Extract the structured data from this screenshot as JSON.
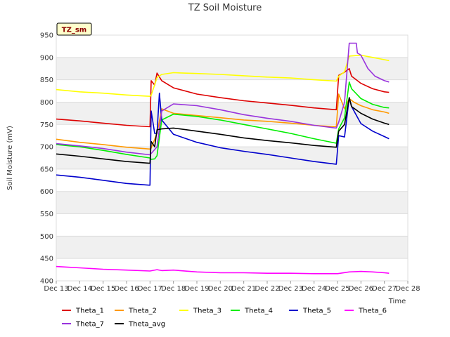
{
  "chart_data": {
    "type": "line",
    "title": "TZ Soil Moisture",
    "xlabel": "Time",
    "ylabel": "Soil Moisture (mV)",
    "badge": "TZ_sm",
    "ylim": [
      400,
      950
    ],
    "xlim": [
      13,
      28
    ],
    "yticks": [
      400,
      450,
      500,
      550,
      600,
      650,
      700,
      750,
      800,
      850,
      900,
      950
    ],
    "xtick_labels": [
      "Dec 13",
      "Dec 14",
      "Dec 15",
      "Dec 16",
      "Dec 17",
      "Dec 18",
      "Dec 19",
      "Dec 20",
      "Dec 21",
      "Dec 22",
      "Dec 23",
      "Dec 24",
      "Dec 25",
      "Dec 26",
      "Dec 27",
      "Dec 28"
    ],
    "xtick_values": [
      13,
      14,
      15,
      16,
      17,
      18,
      19,
      20,
      21,
      22,
      23,
      24,
      25,
      26,
      27,
      28
    ],
    "grid": true,
    "legend_position": "bottom",
    "series": [
      {
        "name": "Theta_1",
        "color": "#dd0000",
        "points": [
          [
            13,
            762
          ],
          [
            14,
            758
          ],
          [
            15,
            753
          ],
          [
            16,
            748
          ],
          [
            17.0,
            745
          ],
          [
            17.05,
            848
          ],
          [
            17.2,
            838
          ],
          [
            17.3,
            865
          ],
          [
            17.5,
            848
          ],
          [
            18,
            832
          ],
          [
            19,
            818
          ],
          [
            20,
            810
          ],
          [
            21,
            803
          ],
          [
            22,
            798
          ],
          [
            23,
            793
          ],
          [
            24,
            787
          ],
          [
            24.95,
            783
          ],
          [
            25.05,
            860
          ],
          [
            25.3,
            867
          ],
          [
            25.5,
            875
          ],
          [
            25.6,
            858
          ],
          [
            26,
            842
          ],
          [
            26.5,
            830
          ],
          [
            27,
            823
          ],
          [
            27.2,
            822
          ]
        ]
      },
      {
        "name": "Theta_2",
        "color": "#ff9900",
        "points": [
          [
            13,
            717
          ],
          [
            14,
            710
          ],
          [
            15,
            705
          ],
          [
            16,
            699
          ],
          [
            17.0,
            695
          ],
          [
            17.05,
            697
          ],
          [
            17.3,
            730
          ],
          [
            17.5,
            785
          ],
          [
            18,
            775
          ],
          [
            19,
            770
          ],
          [
            20,
            765
          ],
          [
            21,
            760
          ],
          [
            22,
            757
          ],
          [
            23,
            753
          ],
          [
            24,
            748
          ],
          [
            24.95,
            745
          ],
          [
            25.05,
            818
          ],
          [
            25.3,
            785
          ],
          [
            25.5,
            808
          ],
          [
            25.7,
            800
          ],
          [
            26,
            792
          ],
          [
            26.5,
            783
          ],
          [
            27,
            778
          ],
          [
            27.2,
            775
          ]
        ]
      },
      {
        "name": "Theta_3",
        "color": "#ffff00",
        "points": [
          [
            13,
            828
          ],
          [
            14,
            823
          ],
          [
            15,
            820
          ],
          [
            16,
            816
          ],
          [
            17.0,
            813
          ],
          [
            17.05,
            815
          ],
          [
            17.3,
            855
          ],
          [
            17.5,
            862
          ],
          [
            18,
            866
          ],
          [
            19,
            864
          ],
          [
            20,
            862
          ],
          [
            21,
            859
          ],
          [
            22,
            856
          ],
          [
            23,
            854
          ],
          [
            24,
            850
          ],
          [
            24.95,
            847
          ],
          [
            25.05,
            858
          ],
          [
            25.3,
            868
          ],
          [
            25.5,
            903
          ],
          [
            26,
            905
          ],
          [
            26.5,
            900
          ],
          [
            27,
            895
          ],
          [
            27.2,
            893
          ]
        ]
      },
      {
        "name": "Theta_4",
        "color": "#00ee00",
        "points": [
          [
            13,
            705
          ],
          [
            14,
            700
          ],
          [
            15,
            692
          ],
          [
            16,
            683
          ],
          [
            17.0,
            675
          ],
          [
            17.05,
            672
          ],
          [
            17.2,
            673
          ],
          [
            17.3,
            680
          ],
          [
            17.5,
            760
          ],
          [
            18,
            773
          ],
          [
            19,
            768
          ],
          [
            20,
            760
          ],
          [
            21,
            750
          ],
          [
            22,
            740
          ],
          [
            23,
            730
          ],
          [
            24,
            718
          ],
          [
            24.95,
            708
          ],
          [
            25.05,
            740
          ],
          [
            25.3,
            765
          ],
          [
            25.5,
            845
          ],
          [
            25.6,
            830
          ],
          [
            26,
            808
          ],
          [
            26.5,
            795
          ],
          [
            27,
            788
          ],
          [
            27.2,
            787
          ]
        ]
      },
      {
        "name": "Theta_5",
        "color": "#0000cc",
        "points": [
          [
            13,
            637
          ],
          [
            14,
            632
          ],
          [
            15,
            625
          ],
          [
            16,
            618
          ],
          [
            17.0,
            614
          ],
          [
            17.05,
            780
          ],
          [
            17.2,
            730
          ],
          [
            17.3,
            730
          ],
          [
            17.4,
            820
          ],
          [
            17.5,
            760
          ],
          [
            18,
            728
          ],
          [
            19,
            710
          ],
          [
            20,
            698
          ],
          [
            21,
            690
          ],
          [
            22,
            683
          ],
          [
            23,
            675
          ],
          [
            24,
            667
          ],
          [
            24.95,
            661
          ],
          [
            25.05,
            725
          ],
          [
            25.3,
            722
          ],
          [
            25.5,
            810
          ],
          [
            25.6,
            790
          ],
          [
            26,
            752
          ],
          [
            26.5,
            735
          ],
          [
            27,
            723
          ],
          [
            27.2,
            718
          ]
        ]
      },
      {
        "name": "Theta_6",
        "color": "#ff00ff",
        "points": [
          [
            13,
            432
          ],
          [
            14,
            429
          ],
          [
            15,
            426
          ],
          [
            16,
            424
          ],
          [
            17,
            422
          ],
          [
            17.3,
            425
          ],
          [
            17.5,
            423
          ],
          [
            18,
            424
          ],
          [
            19,
            420
          ],
          [
            20,
            418
          ],
          [
            21,
            418
          ],
          [
            22,
            417
          ],
          [
            23,
            417
          ],
          [
            24,
            416
          ],
          [
            25,
            416
          ],
          [
            25.5,
            420
          ],
          [
            26,
            421
          ],
          [
            26.5,
            420
          ],
          [
            27,
            418
          ],
          [
            27.2,
            417
          ]
        ]
      },
      {
        "name": "Theta_7",
        "color": "#9933dd",
        "points": [
          [
            13,
            707
          ],
          [
            14,
            702
          ],
          [
            15,
            696
          ],
          [
            16,
            688
          ],
          [
            17.0,
            682
          ],
          [
            17.05,
            685
          ],
          [
            17.3,
            700
          ],
          [
            17.5,
            780
          ],
          [
            18,
            796
          ],
          [
            19,
            792
          ],
          [
            20,
            783
          ],
          [
            21,
            772
          ],
          [
            22,
            764
          ],
          [
            23,
            757
          ],
          [
            24,
            748
          ],
          [
            24.95,
            742
          ],
          [
            25.05,
            755
          ],
          [
            25.3,
            800
          ],
          [
            25.5,
            932
          ],
          [
            25.8,
            932
          ],
          [
            25.85,
            910
          ],
          [
            26,
            905
          ],
          [
            26.3,
            875
          ],
          [
            26.6,
            858
          ],
          [
            27,
            848
          ],
          [
            27.2,
            845
          ]
        ]
      },
      {
        "name": "Theta_avg",
        "color": "#000000",
        "points": [
          [
            13,
            684
          ],
          [
            14,
            679
          ],
          [
            15,
            673
          ],
          [
            16,
            667
          ],
          [
            17.0,
            663
          ],
          [
            17.05,
            712
          ],
          [
            17.2,
            700
          ],
          [
            17.3,
            738
          ],
          [
            17.5,
            740
          ],
          [
            18,
            742
          ],
          [
            19,
            735
          ],
          [
            20,
            728
          ],
          [
            21,
            720
          ],
          [
            22,
            714
          ],
          [
            23,
            709
          ],
          [
            24,
            703
          ],
          [
            24.95,
            699
          ],
          [
            25.05,
            735
          ],
          [
            25.3,
            750
          ],
          [
            25.5,
            810
          ],
          [
            25.6,
            790
          ],
          [
            26,
            775
          ],
          [
            26.5,
            762
          ],
          [
            27,
            753
          ],
          [
            27.2,
            750
          ]
        ]
      }
    ]
  }
}
